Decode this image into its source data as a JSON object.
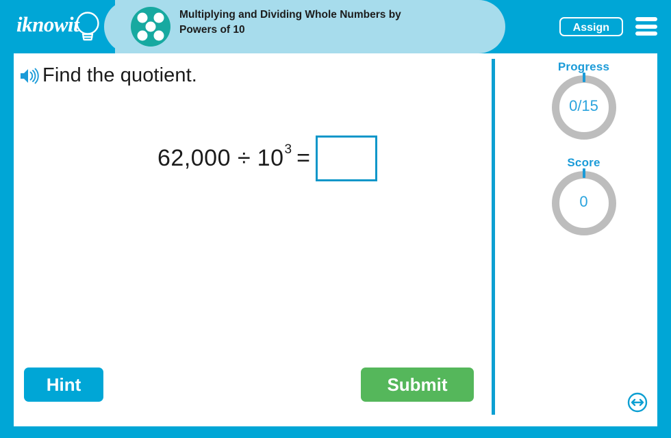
{
  "header": {
    "logo_text": "iknowit",
    "logo_icon": "lightbulb-icon",
    "skill_icon": "five-dots-circle-icon",
    "title": "Multiplying and Dividing Whole Numbers by Powers of 10",
    "title_line1": "Multiplying and Dividing Whole Numbers by",
    "title_line2": "Powers of 10",
    "assign_label": "Assign",
    "menu_icon": "hamburger-menu-icon"
  },
  "question": {
    "audio_icon": "speaker-icon",
    "prompt": "Find the quotient.",
    "expression": {
      "dividend": "62,000",
      "operator": "÷",
      "base": "10",
      "exponent": "3",
      "equals": "=",
      "answer_value": "",
      "answer_placeholder": ""
    }
  },
  "stats": {
    "progress": {
      "label": "Progress",
      "value": "0/15",
      "completed": 0,
      "total": 15
    },
    "score": {
      "label": "Score",
      "value": "0",
      "points": 0
    }
  },
  "actions": {
    "hint_label": "Hint",
    "submit_label": "Submit",
    "resize_icon": "resize-horizontal-icon"
  },
  "colors": {
    "brand_blue": "#00a6d6",
    "band_teal": "#a7dcec",
    "skill_icon_teal": "#17a9a0",
    "submit_green": "#55b75b",
    "ring_gray": "#bdbdbd",
    "accent_blue": "#1b9bd8"
  }
}
